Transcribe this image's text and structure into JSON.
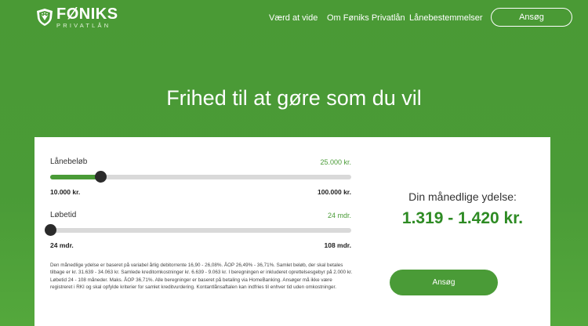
{
  "brand": {
    "name": "FØNIKS",
    "sub": "PRIVATLÅN",
    "icon": "shield-logo-icon"
  },
  "nav": {
    "items": [
      "Værd at vide",
      "Om Føniks Privatlån",
      "Lånebestemmelser"
    ],
    "apply_label": "Ansøg"
  },
  "hero": {
    "title": "Frihed til at gøre som du vil"
  },
  "calculator": {
    "loan": {
      "label": "Lånebeløb",
      "value": "25.000 kr.",
      "min": "10.000 kr.",
      "max": "100.000 kr.",
      "fraction": 0.1667
    },
    "term": {
      "label": "Løbetid",
      "value": "24 mdr.",
      "min": "24 mdr.",
      "max": "108 mdr.",
      "fraction": 0.0
    },
    "disclaimer": "Den månedlige ydelse er baseret på variabel årlig debitorrente 16,90 - 26,08%. ÅOP 26,49% - 36,71%. Samlet beløb, der skal betales tilbage er kr. 31.639 - 34.063 kr. Samlede kreditomkostninger kr. 6.639 - 9.063 kr. I beregningen er inkluderet oprettelsesgebyr på 2.000 kr. Løbetid 24 - 108 måneder. Maks. ÅOP 36,71%. Alle beregninger er baseret på betaling via HomeBanking. Ansøger må ikke være registreret i RKI og skal opfylde kriterier for samlet kreditvurdering. Kontantlånsaftalen kan indfries til enhver tid uden omkostninger.",
    "monthly_label": "Din månedlige ydelse:",
    "monthly_value": "1.319 - 1.420 kr.",
    "apply_label": "Ansøg"
  },
  "colors": {
    "brand_green": "#4a9b37",
    "amount_green": "#2e8b24",
    "thumb": "#2b2b2b",
    "track": "#d9d9d9"
  }
}
